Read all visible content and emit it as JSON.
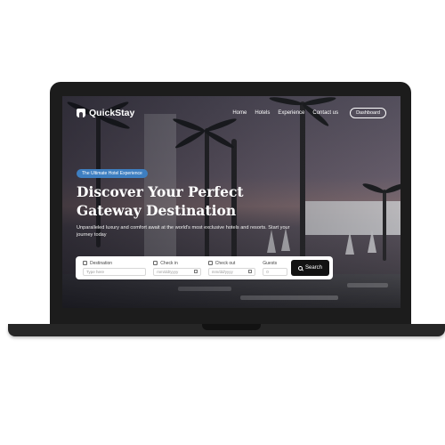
{
  "brand": {
    "name": "QuickStay"
  },
  "nav": {
    "links": [
      "Home",
      "Hotels",
      "Experience",
      "Contact us"
    ],
    "dashboard_label": "Dashboard"
  },
  "hero": {
    "tagline": "The Ultimate Hotel Experience",
    "title": "Discover Your Perfect Gateway Destination",
    "subtitle": "Unparalleled luxury and comfort await at the world's most exclusive hotels and resorts. Start your journey today"
  },
  "search": {
    "destination": {
      "label": "Destination",
      "placeholder": "Type here"
    },
    "check_in": {
      "label": "Check in",
      "placeholder": "mm/dd/yyyy"
    },
    "check_out": {
      "label": "Check out",
      "placeholder": "mm/dd/yyyy"
    },
    "guests": {
      "label": "Guests",
      "value": "0"
    },
    "button_label": "Search"
  },
  "colors": {
    "tagline_bg": "#3e7fc1",
    "search_button_bg": "#121212",
    "laptop_frame": "#1c1c1c"
  }
}
